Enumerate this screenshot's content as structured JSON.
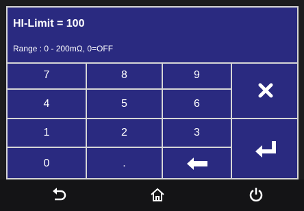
{
  "header": {
    "title": "HI-Limit = 100",
    "range": "Range :  0 - 200mΩ, 0=OFF"
  },
  "keypad": {
    "k7": "7",
    "k8": "8",
    "k9": "9",
    "k4": "4",
    "k5": "5",
    "k6": "6",
    "k1": "1",
    "k2": "2",
    "k3": "3",
    "k0": "0",
    "kdot": ".",
    "backspace_icon": "left-arrow-icon",
    "clear_icon": "close-x-icon",
    "enter_icon": "enter-return-icon"
  },
  "footer": {
    "back_icon": "back-arrow-icon",
    "home_icon": "home-icon",
    "power_icon": "power-icon"
  },
  "colors": {
    "panel_bg": "#2a2a80",
    "grid_line": "#d6d6d6",
    "footer_bg": "#141416",
    "text": "#ffffff"
  }
}
